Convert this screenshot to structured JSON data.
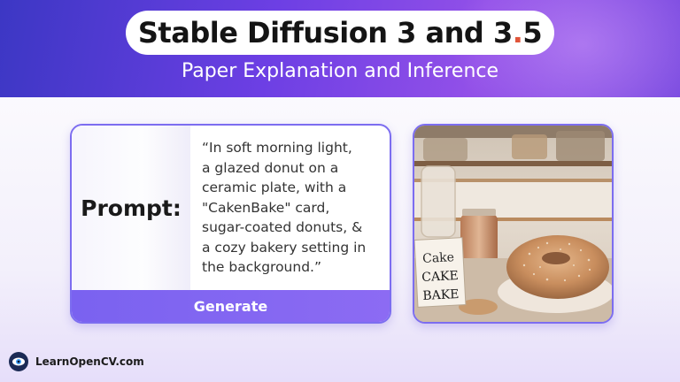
{
  "header": {
    "title_main": "Stable Diffusion 3 and 3",
    "title_dot": ".",
    "title_end": "5",
    "subtitle": "Paper Explanation and Inference"
  },
  "prompt_card": {
    "label": "Prompt:",
    "lines": [
      "“In soft morning light,",
      "a glazed donut on a",
      "ceramic plate, with a",
      "\"CakenBake\" card,",
      "sugar-coated donuts, &",
      "a cozy bakery setting in",
      "the background.”"
    ],
    "button_label": "Generate"
  },
  "image": {
    "card_text": [
      "Cake",
      "CAKE",
      "BAKE"
    ]
  },
  "footer": {
    "brand": "LearnOpenCV.com"
  },
  "colors": {
    "accent": "#7c6df0",
    "button": "#8467f2",
    "title_dot": "#e0553a"
  }
}
